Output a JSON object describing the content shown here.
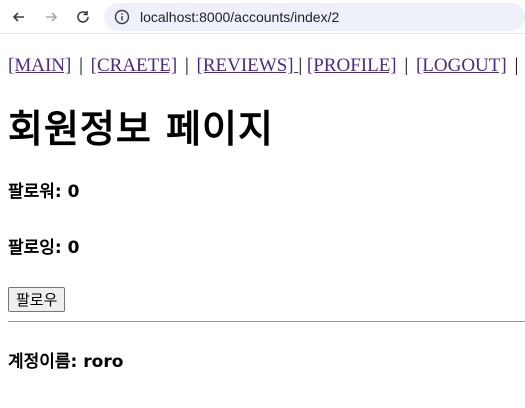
{
  "browser": {
    "url": "localhost:8000/accounts/index/2"
  },
  "nav": {
    "links": [
      "[MAIN]",
      "[CRAETE]",
      "[REVIEWS] ",
      "[PROFILE]",
      "[LOGOUT]"
    ],
    "separator": "|"
  },
  "page": {
    "title": "회원정보 페이지",
    "followers_label": "팔로워: 0",
    "following_label": "팔로잉: 0",
    "follow_button": "팔로우",
    "account_label": "계정이름: roro"
  }
}
